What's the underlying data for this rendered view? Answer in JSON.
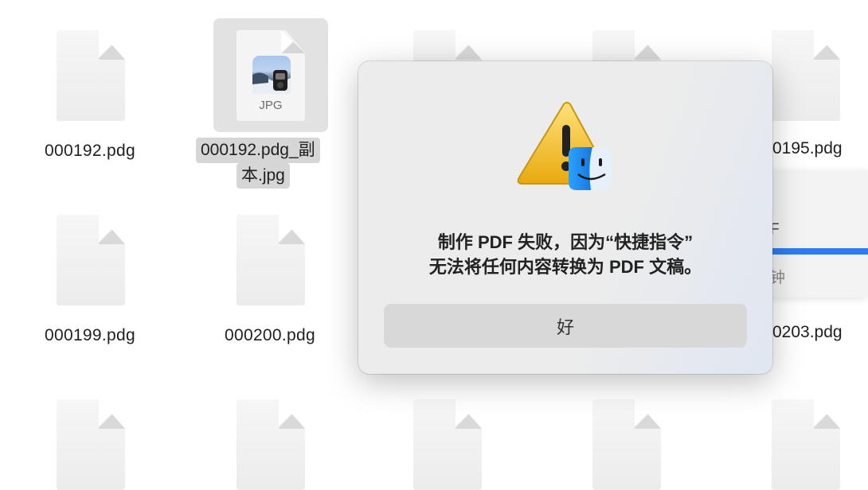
{
  "files": [
    {
      "name": "000192.pdg"
    },
    {
      "name_line1": "000192.pdg_副",
      "name_line2": "本.jpg",
      "type_label": "JPG"
    },
    {
      "name": "0195.pdg"
    },
    {
      "name": "000199.pdg"
    },
    {
      "name": "000200.pdg"
    },
    {
      "name": "0203.pdg"
    }
  ],
  "background_panel": {
    "line1": "F",
    "line2": "钟"
  },
  "dialog": {
    "message_line1": "制作 PDF 失败，因为“快捷指令”",
    "message_line2": "无法将任何内容转换为 PDF 文稿。",
    "ok_label": "好",
    "icon": "warning-finder-icon"
  },
  "colors": {
    "progress": "#2d7cf6",
    "warning": "#f2c21b",
    "finder": "#1e8ef0"
  }
}
